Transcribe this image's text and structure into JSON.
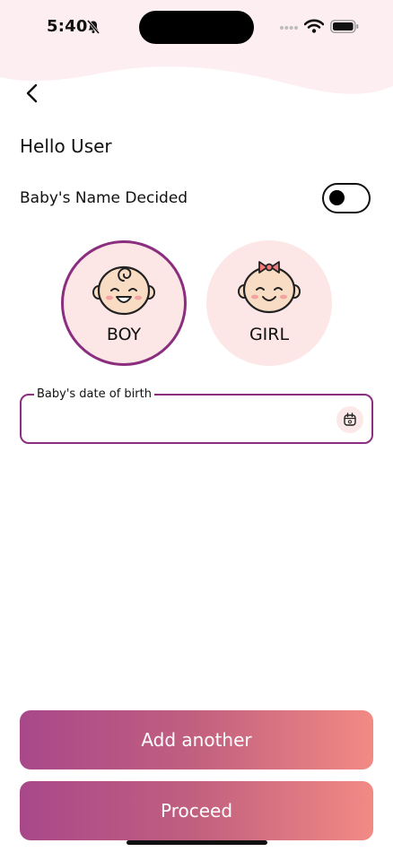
{
  "status_bar": {
    "time": "5:40",
    "icons": [
      "bell-slash-icon",
      "cellular-dots-icon",
      "wifi-icon",
      "battery-icon"
    ]
  },
  "colors": {
    "header_wave": "#fdeef2",
    "accent_border": "#8b2e7f",
    "circle_fill": "#fce6e6",
    "button_gradient_start": "#a8488a",
    "button_gradient_end": "#f28a84"
  },
  "nav": {
    "back_icon": "chevron-left-icon"
  },
  "greeting": "Hello User",
  "name_decided": {
    "label": "Baby's Name Decided",
    "toggle_on": false
  },
  "gender": {
    "selected": "boy",
    "options": [
      {
        "label": "BOY",
        "icon": "baby-boy-icon"
      },
      {
        "label": "GIRL",
        "icon": "baby-girl-icon"
      }
    ]
  },
  "dob": {
    "label": "Baby's date of birth",
    "value": "",
    "icon": "calendar-icon"
  },
  "actions": {
    "add_another": "Add another",
    "proceed": "Proceed"
  }
}
